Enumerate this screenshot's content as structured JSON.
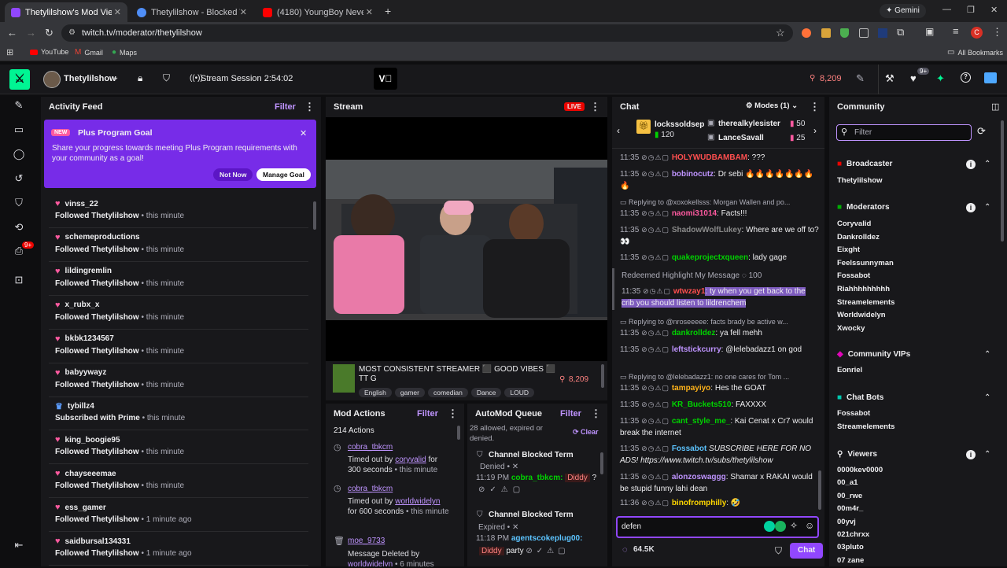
{
  "browser": {
    "tabs": [
      {
        "title": "Thetylilshow's Mod View - ",
        "color": "#9147ff",
        "active": true
      },
      {
        "title": "Thetylilshow - Blocked Terms",
        "color": "#4f8ef7",
        "active": false
      },
      {
        "title": "(4180) YoungBoy Never Bro",
        "color": "#ff0000",
        "active": false
      }
    ],
    "new_tab": "+",
    "gemini": "Gemini",
    "url": "twitch.tv/moderator/thetylilshow",
    "bookmarks": [
      "YouTube",
      "Gmail",
      "Maps"
    ],
    "all_bookmarks": "All Bookmarks",
    "profile_initial": "C"
  },
  "header": {
    "channel": "Thetylilshow",
    "session": "Stream Session 2:54:02",
    "viewers": "8,209",
    "notif_badge": "9+"
  },
  "rail": {
    "badge": "9+"
  },
  "activity": {
    "title": "Activity Feed",
    "filter": "Filter",
    "goal": {
      "tag": "NEW",
      "title": "Plus Program Goal",
      "body": "Share your progress towards meeting Plus Program requirements with your community as a goal!",
      "not_now": "Not Now",
      "manage": "Manage Goal"
    },
    "items": [
      {
        "user": "vinss_22",
        "action": "Followed",
        "target": "Thetylilshow",
        "time": "• this minute",
        "icon": "heart"
      },
      {
        "user": "schemeproductions",
        "action": "Followed",
        "target": "Thetylilshow",
        "time": "• this minute",
        "icon": "heart"
      },
      {
        "user": "lildingremlin",
        "action": "Followed",
        "target": "Thetylilshow",
        "time": "• this minute",
        "icon": "heart"
      },
      {
        "user": "x_rubx_x",
        "action": "Followed",
        "target": "Thetylilshow",
        "time": "• this minute",
        "icon": "heart"
      },
      {
        "user": "bkbk1234567",
        "action": "Followed",
        "target": "Thetylilshow",
        "time": "• this minute",
        "icon": "heart"
      },
      {
        "user": "babyywayz",
        "action": "Followed",
        "target": "Thetylilshow",
        "time": "• this minute",
        "icon": "heart"
      },
      {
        "user": "tybillz4",
        "action": "Subscribed with",
        "target": "Prime",
        "time": "• this minute",
        "icon": "crown"
      },
      {
        "user": "king_boogie95",
        "action": "Followed",
        "target": "Thetylilshow",
        "time": "• this minute",
        "icon": "heart"
      },
      {
        "user": "chayseeemae",
        "action": "Followed",
        "target": "Thetylilshow",
        "time": "• this minute",
        "icon": "heart"
      },
      {
        "user": "ess_gamer",
        "action": "Followed",
        "target": "Thetylilshow",
        "time": "• 1 minute ago",
        "icon": "heart"
      },
      {
        "user": "saidbursal134331",
        "action": "Followed",
        "target": "Thetylilshow",
        "time": "• 1 minute ago",
        "icon": "heart"
      }
    ]
  },
  "stream": {
    "title": "Stream",
    "live": "LIVE",
    "stream_title": "MOST CONSISTENT STREAMER ⬛ GOOD VIBES ⬛ TT G",
    "viewers": "8,209",
    "tags": [
      "English",
      "gamer",
      "comedian",
      "Dance",
      "LOUD"
    ]
  },
  "modactions": {
    "title": "Mod Actions",
    "filter": "Filter",
    "count": "214 Actions",
    "items": [
      {
        "user": "cobra_tbkcm",
        "l1": "Timed out by",
        "by": "coryvalid",
        "l1b": "for",
        "l2": "300 seconds",
        "time": "• this minute"
      },
      {
        "user": "cobra_tbkcm",
        "l1": "Timed out by",
        "by": "worldwidelyn",
        "l1b": "",
        "l2": "for 600 seconds",
        "time": "• this minute"
      },
      {
        "user": "moe_9733",
        "l1": "Message Deleted by",
        "by": "worldwidelyn",
        "l1b": "",
        "l2": "",
        "time": "• 6 minutes"
      }
    ]
  },
  "automod": {
    "title": "AutoMod Queue",
    "filter": "Filter",
    "summary": "28 allowed, expired or denied.",
    "clear": "Clear",
    "items": [
      {
        "title": "Channel Blocked Term",
        "status": "Denied",
        "time": "11:19 PM",
        "user": "cobra_tbkcm:",
        "term": "Diddy",
        "rest": "?"
      },
      {
        "title": "Channel Blocked Term",
        "status": "Expired",
        "time": "11:18 PM",
        "user": "agentscokeplug00:",
        "term": "Diddy",
        "rest": "party"
      }
    ]
  },
  "chat": {
    "title": "Chat",
    "modes": "Modes (1)",
    "leaders": [
      {
        "name": "lockssoldsep",
        "value": "120"
      },
      {
        "name": "therealkylesister",
        "value": "50"
      },
      {
        "name": "LanceSavall",
        "value": "25"
      }
    ],
    "messages": [
      {
        "ts": "11:35",
        "user": "HOLYWUDBAMBAM",
        "color": "#ff4f4f",
        "text": ": ???"
      },
      {
        "ts": "11:35",
        "user": "bobinocutz",
        "color": "#bf94ff",
        "text": ": Dr sebi 🔥🔥🔥🔥🔥🔥🔥🔥"
      },
      {
        "ts": "11:35",
        "user": "naomi31014",
        "color": "#ff5aa0",
        "text": ": Facts!!!"
      },
      {
        "ts": "11:35",
        "user": "ShadowWolfLukey",
        "color": "#8a8a8a",
        "text": ": Where are we off to? 👀"
      },
      {
        "ts": "11:35",
        "user": "quakeprojectxqueen",
        "color": "#00d200",
        "text": ": lady gage"
      },
      {
        "ts": "11:35",
        "user": "wtwzay1",
        "color": "#ff4f4f",
        "text": ": ty when you get back to the crib you should listen to lildrenchem"
      },
      {
        "ts": "11:35",
        "user": "dankrolldez",
        "color": "#00d200",
        "text": ": ya fell mehh"
      },
      {
        "ts": "11:35",
        "user": "leftstickcurry",
        "color": "#bf94ff",
        "text": ": @lelebadazz1 on god"
      },
      {
        "ts": "11:35",
        "user": "tampayiyo",
        "color": "#ffb31a",
        "text": ": Hes the GOAT"
      },
      {
        "ts": "11:35",
        "user": "KR_Buckets510",
        "color": "#00d200",
        "text": ": FAXXXX"
      },
      {
        "ts": "11:35",
        "user": "cant_style_me_",
        "color": "#00d200",
        "text": ": Kai Cenat x Cr7 would break the internet"
      },
      {
        "ts": "11:35",
        "user": "Fossabot",
        "color": "#5cc4ff",
        "text": " SUBSCRIBE HERE FOR NO ADS! https://www.twitch.tv/subs/thetylilshow"
      },
      {
        "ts": "11:35",
        "user": "alonzoswaggg",
        "color": "#bf94ff",
        "text": ": Shamar x RAKAI would be stupid funny lahi dean"
      },
      {
        "ts": "11:36",
        "user": "binofromphilly",
        "color": "#ffd700",
        "text": ": 🤣"
      }
    ],
    "replies": [
      "Replying to @xoxokellsss: Morgan Wallen and po...",
      "Replying to @nroseeeee: facts brady be active w...",
      "Replying to @lelebadazz1: no one cares for Tom ..."
    ],
    "redeemed": "Redeemed Highlight My Message",
    "redeemed_cost": "100",
    "input_value": "defen",
    "points": "64.5K",
    "chat_button": "Chat"
  },
  "community": {
    "title": "Community",
    "filter_placeholder": "Filter",
    "broadcaster_label": "Broadcaster",
    "broadcaster": "Thetylilshow",
    "moderators_label": "Moderators",
    "moderators": [
      "Coryvalid",
      "Dankrolldez",
      "Eixght",
      "Feelssunnyman",
      "Fossabot",
      "Riahhhhhhhhh",
      "Streamelements",
      "Worldwidelyn",
      "Xwocky"
    ],
    "vips_label": "Community VIPs",
    "vips": [
      "Eonriel"
    ],
    "bots_label": "Chat Bots",
    "bots": [
      "Fossabot",
      "Streamelements"
    ],
    "viewers_label": "Viewers",
    "viewers": [
      "0000kev0000",
      "00_a1",
      "00_rwe",
      "00m4r_",
      "00yvj",
      "021chrxx",
      "03pluto",
      "07 zane"
    ]
  }
}
